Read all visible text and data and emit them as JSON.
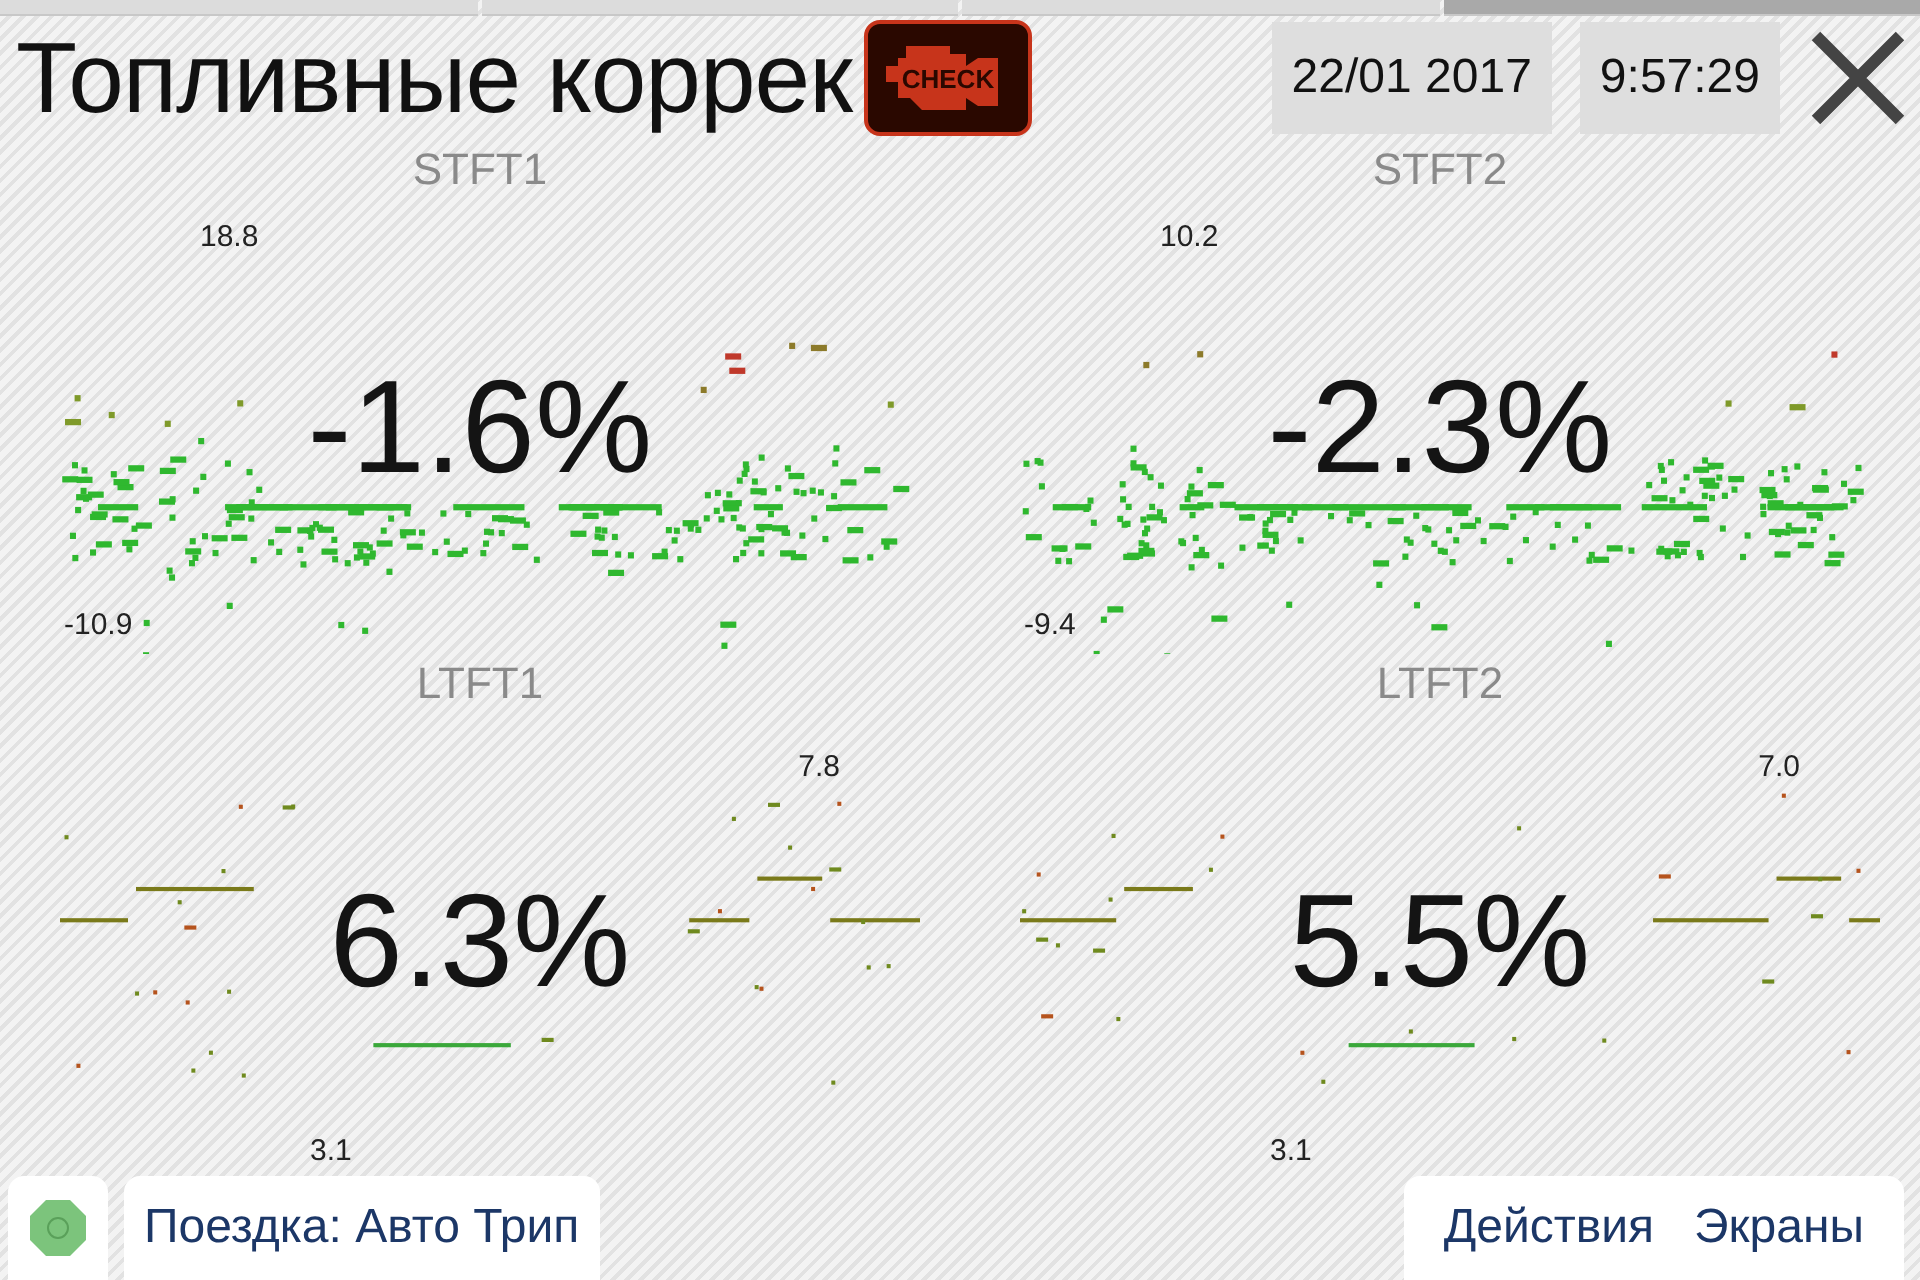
{
  "pages": [
    {
      "selected": false
    },
    {
      "selected": false
    },
    {
      "selected": false
    },
    {
      "selected": true
    }
  ],
  "header": {
    "title": "Топливные коррек",
    "date": "22/01 2017",
    "time": "9:57:29",
    "check_label": "CHECK"
  },
  "panels": [
    {
      "kind": "short",
      "name": "STFT1",
      "value": "-1.6%",
      "max": "18.8",
      "min": "-10.9"
    },
    {
      "kind": "short",
      "name": "STFT2",
      "value": "-2.3%",
      "max": "10.2",
      "min": "-9.4"
    },
    {
      "kind": "long",
      "name": "LTFT1",
      "value": "6.3%",
      "max": "7.8",
      "min": "3.1"
    },
    {
      "kind": "long",
      "name": "LTFT2",
      "value": "5.5%",
      "max": "7.0",
      "min": "3.1"
    }
  ],
  "footer": {
    "trip": "Поездка: Авто Трип",
    "actions": [
      "Действия",
      "Экраны"
    ]
  }
}
